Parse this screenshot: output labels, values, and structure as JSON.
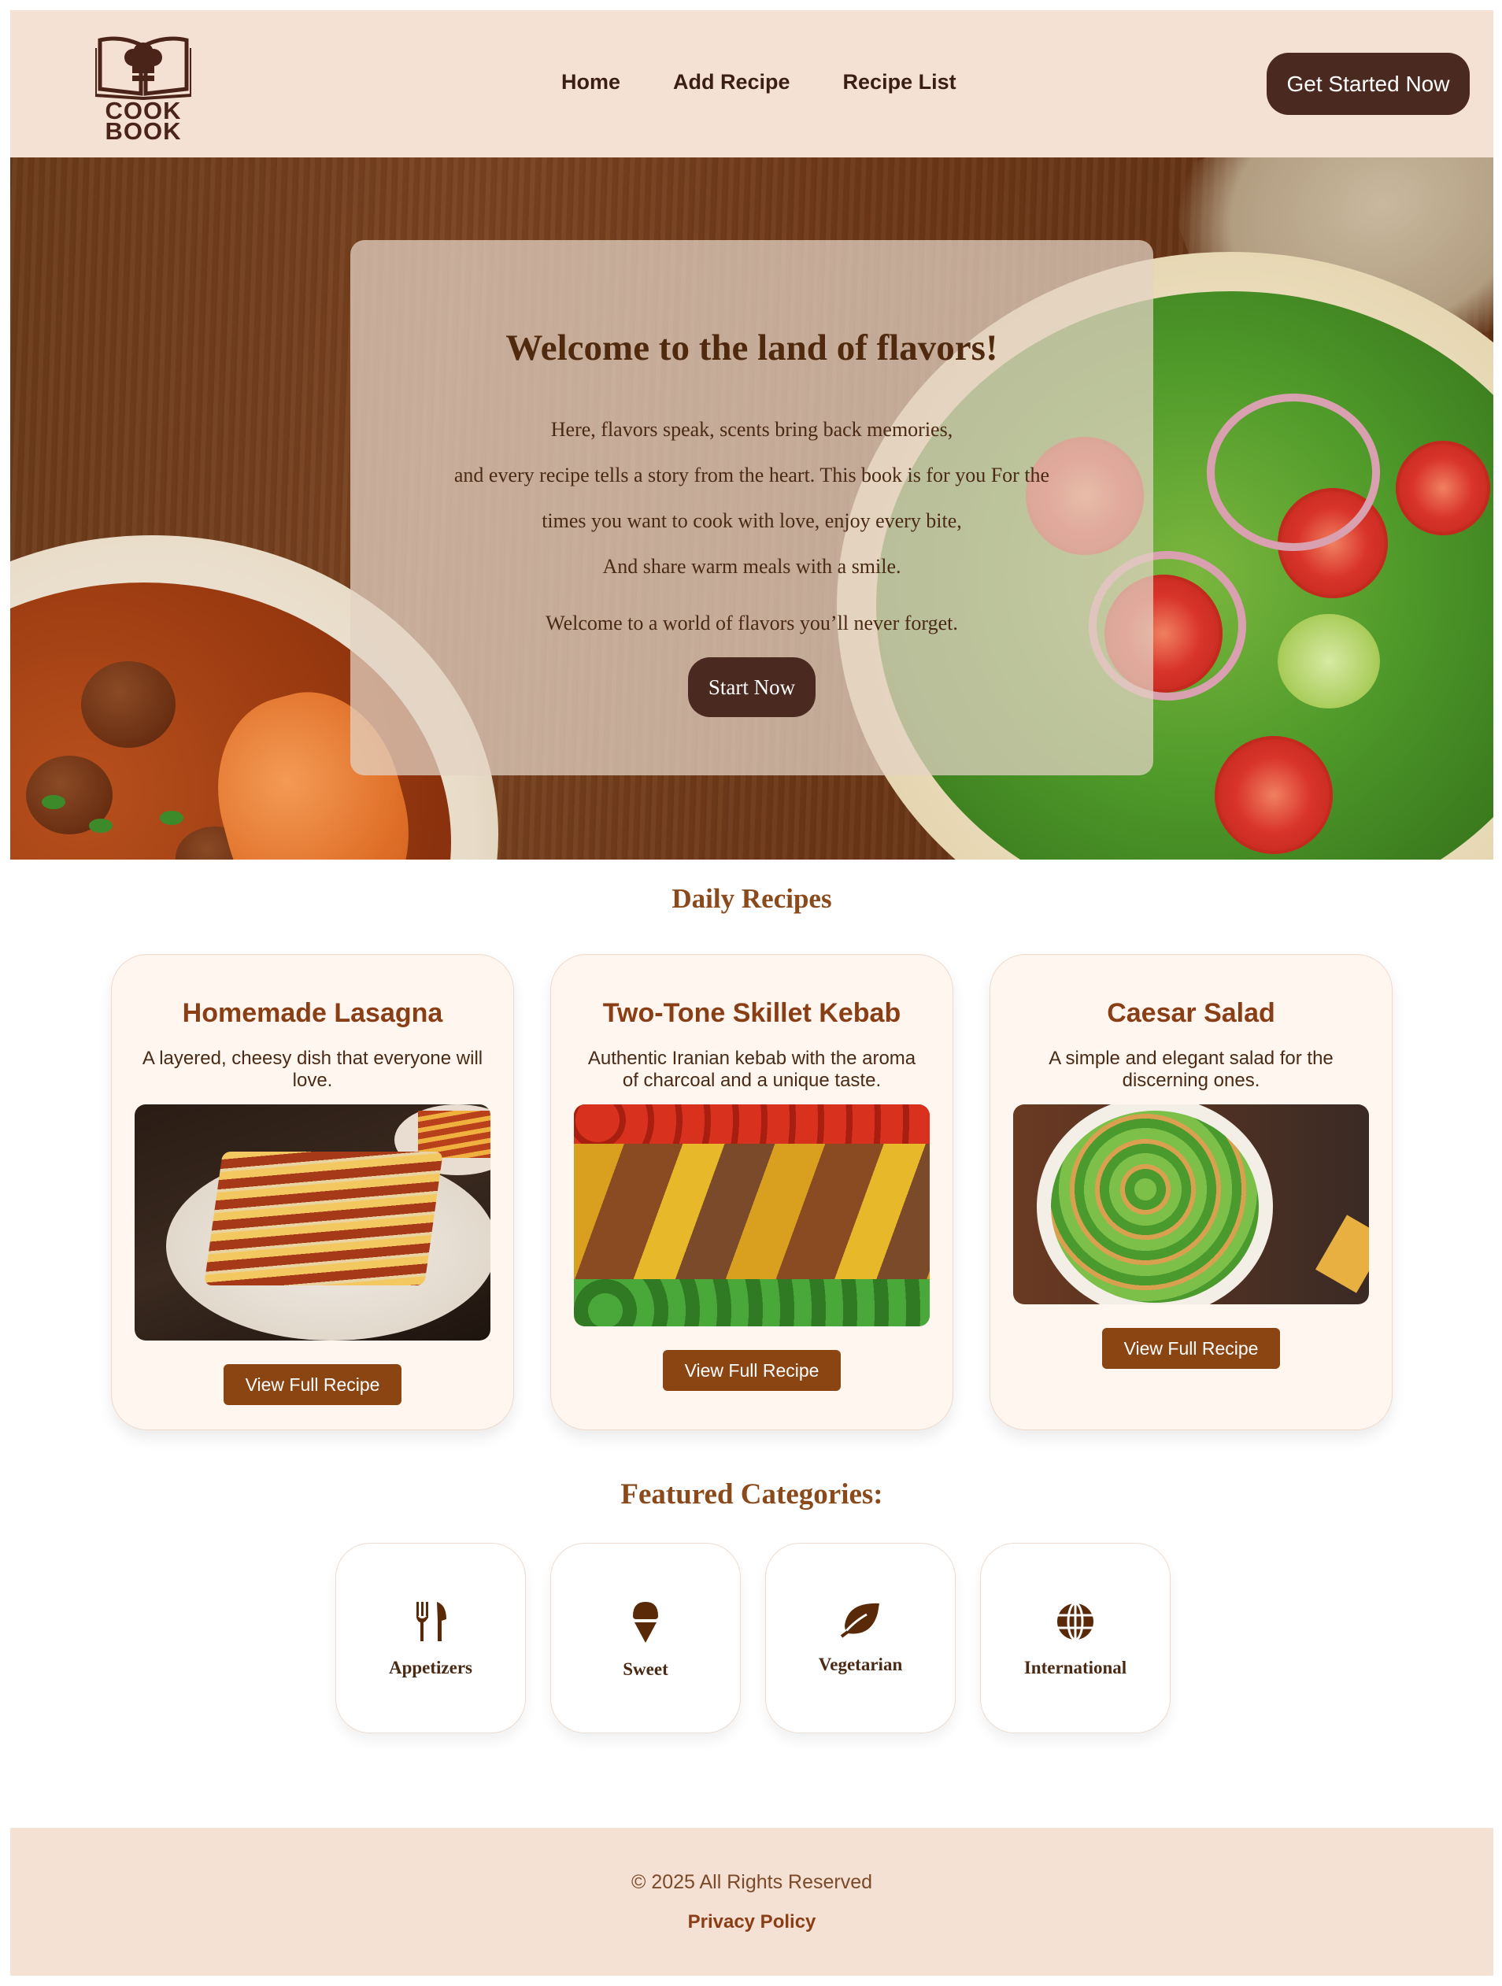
{
  "header": {
    "logo_line1": "COOK",
    "logo_line2": "BOOK",
    "nav": [
      "Home",
      "Add Recipe",
      "Recipe List"
    ],
    "cta": "Get Started Now"
  },
  "hero": {
    "title": "Welcome to the land of flavors!",
    "lines": [
      "Here, flavors speak, scents bring back memories,",
      "and every recipe tells a story from the heart. This book is for you For the",
      "times you want to cook with love, enjoy every bite,",
      "And share warm meals with a smile."
    ],
    "tagline": "Welcome to a world of flavors you’ll never forget.",
    "button": "Start Now"
  },
  "daily": {
    "title": "Daily Recipes",
    "recipes": [
      {
        "title": "Homemade Lasagna",
        "desc": "A layered, cheesy dish that everyone will love.",
        "button": "View Full Recipe"
      },
      {
        "title": "Two-Tone Skillet Kebab",
        "desc": "Authentic Iranian kebab with the aroma of charcoal and a unique taste.",
        "button": "View Full Recipe"
      },
      {
        "title": "Caesar Salad",
        "desc": "A simple and elegant salad for the discerning ones.",
        "button": "View Full Recipe"
      }
    ]
  },
  "featured": {
    "title": "Featured Categories:",
    "categories": [
      {
        "label": "Appetizers",
        "icon": "utensils-icon"
      },
      {
        "label": "Sweet",
        "icon": "ice-cream-icon"
      },
      {
        "label": "Vegetarian",
        "icon": "leaf-icon"
      },
      {
        "label": "International",
        "icon": "globe-icon"
      }
    ]
  },
  "footer": {
    "copyright": "© 2025 All Rights Reserved",
    "privacy": "Privacy Policy"
  },
  "colors": {
    "header_bg": "#f5e1d3",
    "dark_button": "#4a2a20",
    "accent_brown": "#8b4513"
  }
}
